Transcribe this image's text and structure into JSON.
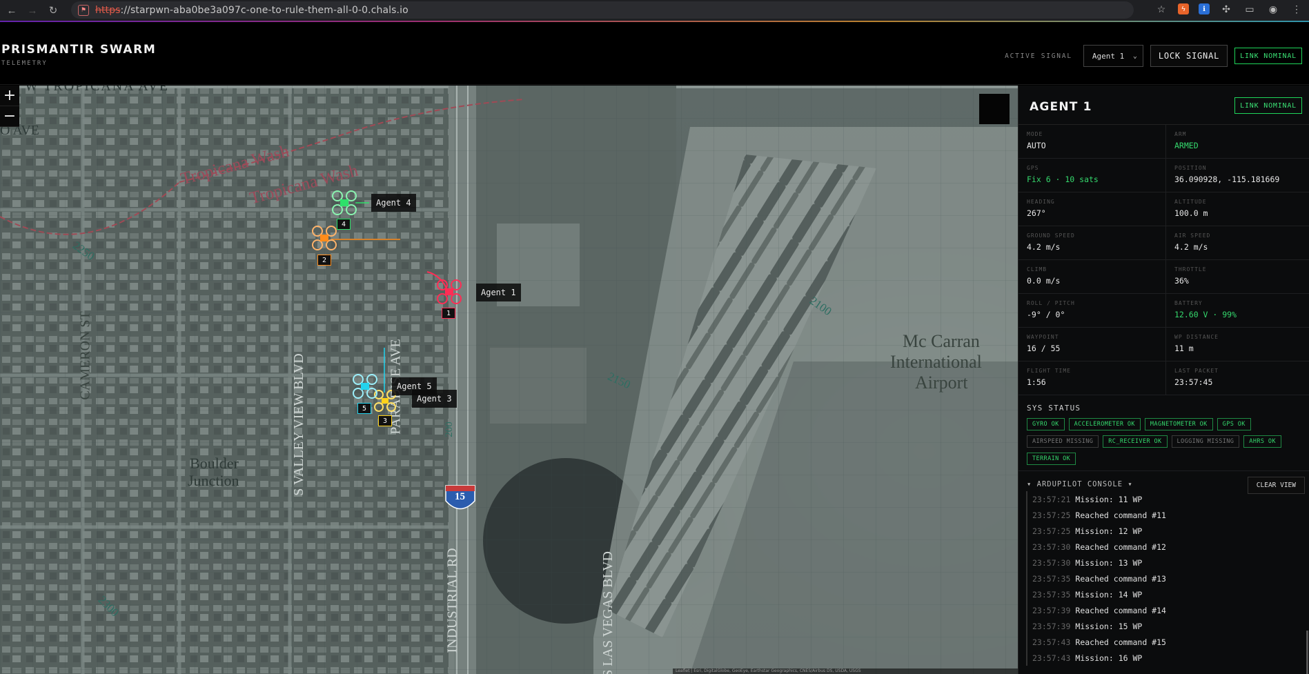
{
  "browser": {
    "url_scheme": "https",
    "url_rest": "://starpwn-aba0be3a097c-one-to-rule-them-all-0-0.chals.io",
    "icons": [
      "back-arrow-icon",
      "forward-arrow-icon",
      "reload-icon",
      "star-icon",
      "extension-icon",
      "puzzle-icon",
      "download-icon",
      "profile-icon",
      "menu-icon"
    ]
  },
  "header": {
    "brand_title": "PRISMANTIR SWARM",
    "brand_subtitle": "TELEMETRY",
    "active_signal_label": "ACTIVE SIGNAL",
    "agent_select_value": "Agent 1",
    "lock_button": "LOCK SIGNAL",
    "link_status": "LINK NOMINAL"
  },
  "map": {
    "zoom_in": "+",
    "zoom_out": "−",
    "labels": {
      "street_top": "W TROPICANA AVE",
      "street_left": "O AVE",
      "wash1": "Tropicana Wash",
      "wash2": "Tropicana Wash",
      "cameron": "CAMERON ST",
      "valley": "S VALLEY VIEW BLVD",
      "boulder1": "Boulder",
      "boulder2": "Junction",
      "industrial": "INDUSTRIAL RD",
      "paradise": "PARADISE AVE",
      "vegas": "S LAS VEGAS BLVD",
      "airport1": "Mc Carran",
      "airport2": "International",
      "airport3": "Airport",
      "contour_2250": "2250",
      "contour_2100": "2100",
      "contour_2150": "2150",
      "contour_2300": "2300",
      "contour_200": "200",
      "interstate": "15"
    },
    "agents": [
      {
        "name": "Agent 1",
        "num": "1",
        "color": "#ff2d55"
      },
      {
        "name": "Agent 2",
        "num": "2",
        "color": "#ff8c1a"
      },
      {
        "name": "Agent 3",
        "num": "3",
        "color": "#ffd21a"
      },
      {
        "name": "Agent 4",
        "num": "4",
        "color": "#2ee06a"
      },
      {
        "name": "Agent 5",
        "num": "5",
        "color": "#22d3ee"
      }
    ],
    "attribution": "Leaflet | Esri, DigitalGlobe, GeoEye, Earthstar Geographics, CNES/Airbus DS, USDA, USGS"
  },
  "panel": {
    "title": "AGENT 1",
    "link_status": "LINK NOMINAL",
    "fields": [
      {
        "key": "MODE",
        "value": "AUTO",
        "green": false
      },
      {
        "key": "ARM",
        "value": "ARMED",
        "green": true
      },
      {
        "key": "GPS",
        "value": "Fix 6 · 10 sats",
        "green": true
      },
      {
        "key": "POSITION",
        "value": "36.090928, -115.181669",
        "green": false
      },
      {
        "key": "HEADING",
        "value": "267°",
        "green": false
      },
      {
        "key": "ALTITUDE",
        "value": "100.0 m",
        "green": false
      },
      {
        "key": "GROUND SPEED",
        "value": "4.2 m/s",
        "green": false
      },
      {
        "key": "AIR SPEED",
        "value": "4.2 m/s",
        "green": false
      },
      {
        "key": "CLIMB",
        "value": "0.0 m/s",
        "green": false
      },
      {
        "key": "THROTTLE",
        "value": "36%",
        "green": false
      },
      {
        "key": "ROLL / PITCH",
        "value": "-9° / 0°",
        "green": false
      },
      {
        "key": "BATTERY",
        "value": "12.60 V · 99%",
        "green": true
      },
      {
        "key": "WAYPOINT",
        "value": "16 / 55",
        "green": false
      },
      {
        "key": "WP DISTANCE",
        "value": "11 m",
        "green": false
      },
      {
        "key": "FLIGHT TIME",
        "value": "1:56",
        "green": false
      },
      {
        "key": "LAST PACKET",
        "value": "23:57:45",
        "green": false
      }
    ],
    "sys_status_title": "SYS STATUS",
    "sys_status": [
      {
        "label": "GYRO OK",
        "ok": true
      },
      {
        "label": "ACCELEROMETER OK",
        "ok": true
      },
      {
        "label": "MAGNETOMETER OK",
        "ok": true
      },
      {
        "label": "GPS OK",
        "ok": true
      },
      {
        "label": "AIRSPEED MISSING",
        "ok": false
      },
      {
        "label": "RC_RECEIVER OK",
        "ok": true
      },
      {
        "label": "LOGGING MISSING",
        "ok": false
      },
      {
        "label": "AHRS OK",
        "ok": true
      },
      {
        "label": "TERRAIN OK",
        "ok": true
      }
    ],
    "console_title": "▾ ARDUPILOT CONSOLE ▾",
    "clear_button": "CLEAR VIEW",
    "console_lines": [
      {
        "time": "23:57:21",
        "msg": "Mission: 11 WP"
      },
      {
        "time": "23:57:25",
        "msg": "Reached command #11"
      },
      {
        "time": "23:57:25",
        "msg": "Mission: 12 WP"
      },
      {
        "time": "23:57:30",
        "msg": "Reached command #12"
      },
      {
        "time": "23:57:30",
        "msg": "Mission: 13 WP"
      },
      {
        "time": "23:57:35",
        "msg": "Reached command #13"
      },
      {
        "time": "23:57:35",
        "msg": "Mission: 14 WP"
      },
      {
        "time": "23:57:39",
        "msg": "Reached command #14"
      },
      {
        "time": "23:57:39",
        "msg": "Mission: 15 WP"
      },
      {
        "time": "23:57:43",
        "msg": "Reached command #15"
      },
      {
        "time": "23:57:43",
        "msg": "Mission: 16 WP"
      }
    ]
  }
}
